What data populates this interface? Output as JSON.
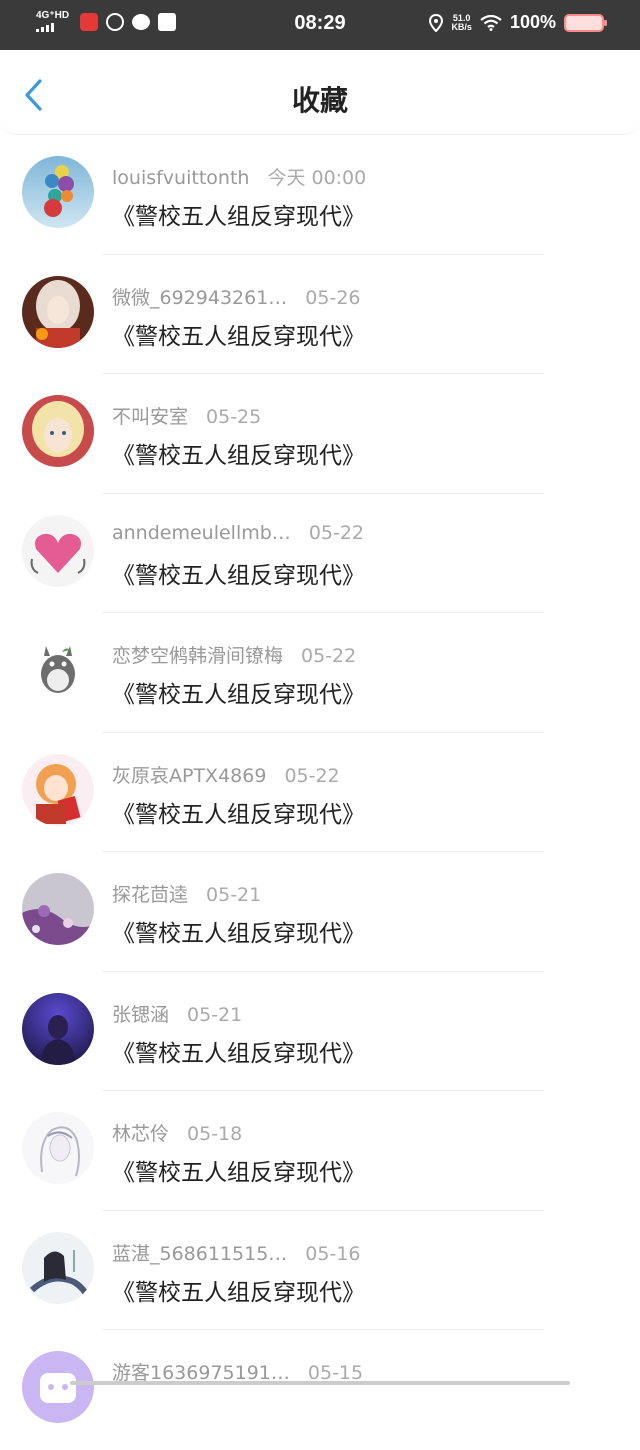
{
  "status_bar": {
    "network": "4G⁺HD",
    "time": "08:29",
    "speed_value": "51.0",
    "speed_unit": "KB/s",
    "battery": "100%"
  },
  "header": {
    "title": "收藏",
    "back_icon": "chevron-left-icon"
  },
  "colors": {
    "accent": "#3a9bdc",
    "status_bar_bg": "#3a3a3a"
  },
  "favorites": [
    {
      "user": "louisfvuittonth",
      "time": "今天 00:00",
      "book": "《警校五人组反穿现代》"
    },
    {
      "user": "微微_692943261…",
      "time": "05-26",
      "book": "《警校五人组反穿现代》"
    },
    {
      "user": "不叫安室",
      "time": "05-25",
      "book": "《警校五人组反穿现代》"
    },
    {
      "user": "anndemeulellmb…",
      "time": "05-22",
      "book": "《警校五人组反穿现代》"
    },
    {
      "user": "恋梦空鸺韩滑间镣梅",
      "time": "05-22",
      "book": "《警校五人组反穿现代》"
    },
    {
      "user": "灰原哀APTX4869",
      "time": "05-22",
      "book": "《警校五人组反穿现代》"
    },
    {
      "user": "探花茴逵",
      "time": "05-21",
      "book": "《警校五人组反穿现代》"
    },
    {
      "user": "张锶涵",
      "time": "05-21",
      "book": "《警校五人组反穿现代》"
    },
    {
      "user": "林芯伶",
      "time": "05-18",
      "book": "《警校五人组反穿现代》"
    },
    {
      "user": "蓝湛_568611515…",
      "time": "05-16",
      "book": "《警校五人组反穿现代》"
    },
    {
      "user": "游客1636975191…",
      "time": "05-15",
      "book": ""
    }
  ]
}
